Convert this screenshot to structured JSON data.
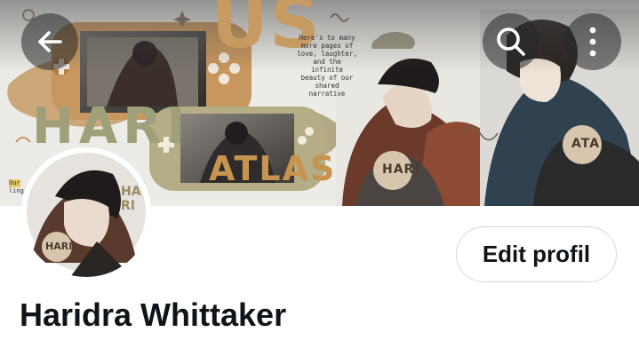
{
  "header": {
    "back_icon": "arrow-left-icon",
    "search_icon": "search-icon",
    "more_icon": "more-vertical-icon"
  },
  "banner": {
    "caption": [
      "Here's to many",
      "more pages of",
      "love, laughter,",
      "and the infinite",
      "beauty of our",
      "shared",
      "narrative"
    ],
    "word_us": "US",
    "word_hari": "HARI",
    "word_atlas": "ATLAS",
    "badge_hari": "HARI",
    "badge_ata": "ATA",
    "corner_text_1": "Our",
    "corner_text_2": "ling"
  },
  "avatar": {
    "side_text": "HA RI",
    "badge": "HARI"
  },
  "profile": {
    "edit_label": "Edit profil",
    "display_name": "Haridra Whittaker"
  },
  "colors": {
    "name_text": "#0f1419",
    "button_border": "#cfd9de",
    "overlay": "#282828"
  }
}
